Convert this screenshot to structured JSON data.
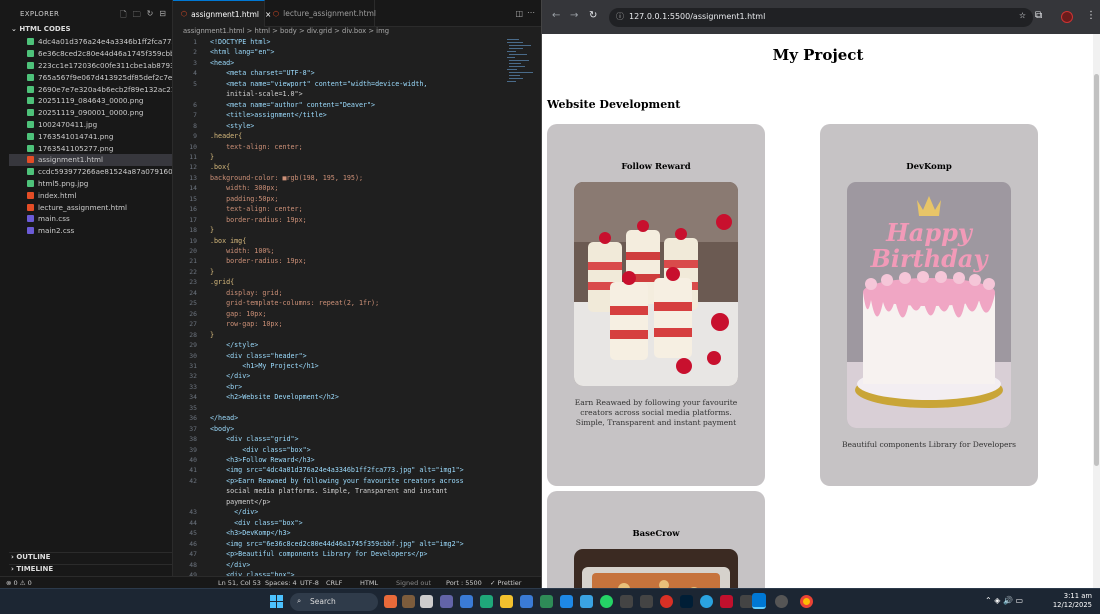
{
  "vscode": {
    "explorer_title": "EXPLORER",
    "section": "HTML CODES",
    "files": [
      {
        "name": "4dc4a01d376a24e4a3346b1ff2fca773.jpg",
        "kind": "img"
      },
      {
        "name": "6e36c8ced2c80e44d46a1745f359cbbf.jpg",
        "kind": "img"
      },
      {
        "name": "223cc1e172036c00fe311cbe1ab8793f.jpg",
        "kind": "img"
      },
      {
        "name": "765a567f9e067d413925df85def2c7eb.jpg",
        "kind": "img"
      },
      {
        "name": "2690e7e7e320a4b6ecb2f89e132ac21f.jpg",
        "kind": "img"
      },
      {
        "name": "20251119_084643_0000.png",
        "kind": "img"
      },
      {
        "name": "20251119_090001_0000.png",
        "kind": "img"
      },
      {
        "name": "1002470411.jpg",
        "kind": "img"
      },
      {
        "name": "1763541014741.png",
        "kind": "img"
      },
      {
        "name": "1763541105277.png",
        "kind": "img"
      },
      {
        "name": "assignment1.html",
        "kind": "html"
      },
      {
        "name": "ccdc593977266ae81524a87a07916086.jpg",
        "kind": "img"
      },
      {
        "name": "html5.png.jpg",
        "kind": "img"
      },
      {
        "name": "index.html",
        "kind": "html"
      },
      {
        "name": "lecture_assignment.html",
        "kind": "html"
      },
      {
        "name": "main.css",
        "kind": "css"
      },
      {
        "name": "main2.css",
        "kind": "css"
      }
    ],
    "outline": "OUTLINE",
    "timeline": "TIMELINE",
    "tabs": [
      {
        "label": "assignment1.html"
      },
      {
        "label": "lecture_assignment.html"
      }
    ],
    "breadcrumb": "assignment1.html > html > body > div.grid > div.box > img",
    "code": [
      {
        "n": "1",
        "t": "<!DOCTYPE html>"
      },
      {
        "n": "2",
        "t": "<html lang=\"en\">"
      },
      {
        "n": "3",
        "t": "<head>"
      },
      {
        "n": "4",
        "t": "    <meta charset=\"UTF-8\">"
      },
      {
        "n": "5",
        "t": "    <meta name=\"viewport\" content=\"width=device-width,"
      },
      {
        "n": "",
        "t": "    initial-scale=1.0\">"
      },
      {
        "n": "6",
        "t": "    <meta name=\"author\" content=\"Deaver\">"
      },
      {
        "n": "7",
        "t": "    <title>assignment</title>"
      },
      {
        "n": "8",
        "t": "    <style>"
      },
      {
        "n": "9",
        "t": ".header{"
      },
      {
        "n": "10",
        "t": "    text-align: center;"
      },
      {
        "n": "11",
        "t": "}"
      },
      {
        "n": "12",
        "t": ".box{"
      },
      {
        "n": "13",
        "t": "background-color: ■rgb(198, 195, 195);"
      },
      {
        "n": "14",
        "t": "    width: 300px;"
      },
      {
        "n": "15",
        "t": "    padding:50px;"
      },
      {
        "n": "16",
        "t": "    text-align: center;"
      },
      {
        "n": "17",
        "t": "    border-radius: 19px;"
      },
      {
        "n": "18",
        "t": "}"
      },
      {
        "n": "19",
        "t": ".box img{"
      },
      {
        "n": "20",
        "t": "    width: 100%;"
      },
      {
        "n": "21",
        "t": "    border-radius: 19px;"
      },
      {
        "n": "22",
        "t": "}"
      },
      {
        "n": "23",
        "t": ".grid{"
      },
      {
        "n": "24",
        "t": "    display: grid;"
      },
      {
        "n": "25",
        "t": "    grid-template-columns: repeat(2, 1fr);"
      },
      {
        "n": "26",
        "t": "    gap: 10px;"
      },
      {
        "n": "27",
        "t": "    row-gap: 10px;"
      },
      {
        "n": "28",
        "t": "}"
      },
      {
        "n": "29",
        "t": "    </style>"
      },
      {
        "n": "30",
        "t": "    <div class=\"header\">"
      },
      {
        "n": "31",
        "t": "        <h1>My Project</h1>"
      },
      {
        "n": "32",
        "t": "    </div>"
      },
      {
        "n": "33",
        "t": "    <br>"
      },
      {
        "n": "34",
        "t": "    <h2>Website Development</h2>"
      },
      {
        "n": "35",
        "t": ""
      },
      {
        "n": "36",
        "t": "</head>"
      },
      {
        "n": "37",
        "t": "<body>"
      },
      {
        "n": "38",
        "t": "    <div class=\"grid\">"
      },
      {
        "n": "39",
        "t": "        <div class=\"box\">"
      },
      {
        "n": "40",
        "t": "    <h3>Follow Reward</h3>"
      },
      {
        "n": "41",
        "t": "    <img src=\"4dc4a01d376a24e4a3346b1ff2fca773.jpg\" alt=\"img1\">"
      },
      {
        "n": "42",
        "t": "    <p>Earn Reawaed by following your favourite creators across"
      },
      {
        "n": "",
        "t": "    social media platforms. Simple, Transparent and instant"
      },
      {
        "n": "",
        "t": "    payment</p>"
      },
      {
        "n": "43",
        "t": "      </div>"
      },
      {
        "n": "44",
        "t": "      <div class=\"box\">"
      },
      {
        "n": "45",
        "t": "    <h3>DevKomp</h3>"
      },
      {
        "n": "46",
        "t": "    <img src=\"6e36c8ced2c80e44d46a1745f359cbbf.jpg\" alt=\"img2\">"
      },
      {
        "n": "47",
        "t": "    <p>Beautiful components Library for Developers</p>"
      },
      {
        "n": "48",
        "t": "    </div>"
      },
      {
        "n": "49",
        "t": "    <div class=\"box\">"
      }
    ],
    "status": {
      "left": "⊗ 0 ⚠ 0",
      "position": "Ln 51, Col 53",
      "spaces": "Spaces: 4",
      "encoding": "UTF-8",
      "eol": "CRLF",
      "lang": "HTML",
      "account": "Signed out",
      "port": "Port : 5500",
      "prettier": "✓ Prettier"
    }
  },
  "browser": {
    "url": "127.0.0.1:5500/assignment1.html",
    "page": {
      "h1": "My Project",
      "h2": "Website Development",
      "boxes": [
        {
          "title": "Follow Reward",
          "text": "Earn Reawaed by following your favourite creators across social media platforms. Simple, Transparent and instant payment"
        },
        {
          "title": "DevKomp",
          "text": "Beautiful components Library for Developers"
        },
        {
          "title": "BaseCrow",
          "text": ""
        }
      ],
      "cake_text_1": "Happy",
      "cake_text_2": "Birthday",
      "box_color": "#c6c3c5"
    }
  },
  "taskbar": {
    "search": "Search",
    "time": "3:11 am",
    "date": "12/12/2025"
  }
}
